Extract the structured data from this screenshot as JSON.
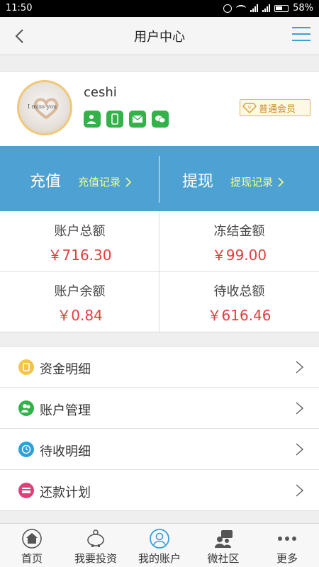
{
  "status_bar": {
    "time": "11:50",
    "battery": "58%"
  },
  "header": {
    "title": "用户中心"
  },
  "profile": {
    "username": "ceshi",
    "avatar_text": "I miss you",
    "vip_label": "普通会员"
  },
  "actions": {
    "recharge": {
      "label": "充值",
      "record": "充值记录"
    },
    "withdraw": {
      "label": "提现",
      "record": "提现记录"
    }
  },
  "summary": [
    {
      "label": "账户总额",
      "amount": "￥716.30"
    },
    {
      "label": "冻结金额",
      "amount": "￥99.00"
    },
    {
      "label": "账户余额",
      "amount": "￥0.84"
    },
    {
      "label": "待收总额",
      "amount": "￥616.46"
    }
  ],
  "menu": [
    {
      "label": "资金明细",
      "icon": "wallet-icon",
      "color": "#f3c34a"
    },
    {
      "label": "账户管理",
      "icon": "users-icon",
      "color": "#33b24a"
    },
    {
      "label": "待收明细",
      "icon": "clock-icon",
      "color": "#2f9fd8"
    },
    {
      "label": "还款计划",
      "icon": "card-icon",
      "color": "#e0407a"
    }
  ],
  "tabs": [
    {
      "label": "首页",
      "icon": "home-icon"
    },
    {
      "label": "我要投资",
      "icon": "piggy-bank-icon"
    },
    {
      "label": "我的账户",
      "icon": "user-icon",
      "active": true
    },
    {
      "label": "微社区",
      "icon": "community-icon"
    },
    {
      "label": "更多",
      "icon": "more-icon"
    }
  ],
  "colors": {
    "accent": "#4da2d3",
    "amount": "#e43c3c",
    "record_link": "#f6ff86"
  }
}
